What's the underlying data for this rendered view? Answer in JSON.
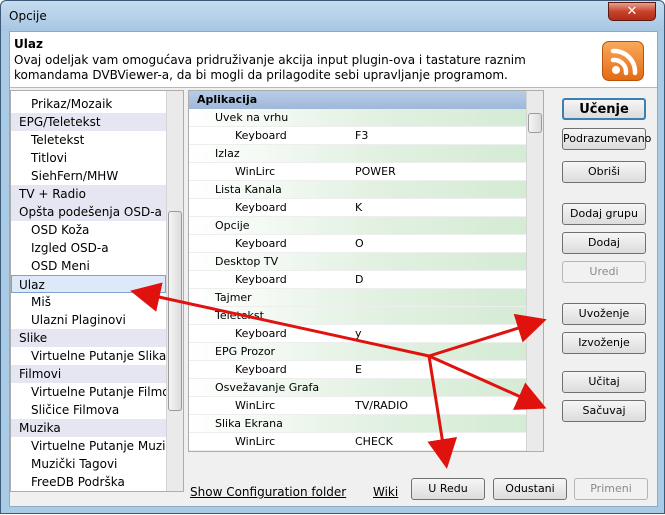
{
  "window": {
    "title": "Opcije",
    "close_label": "✕"
  },
  "header": {
    "title": "Ulaz",
    "description": "Ovaj odeljak vam omogućava pridruživanje akcija input plugin-ova i tastature raznim komandama DVBViewer-a, da bi mogli da prilagodite sebi upravljanje programom.",
    "icon": "rss-icon"
  },
  "sidebar": {
    "items": [
      {
        "label": "Prikaz/Mozaik",
        "kind": "child"
      },
      {
        "label": "EPG/Teletekst",
        "kind": "cat"
      },
      {
        "label": "Teletekst",
        "kind": "child"
      },
      {
        "label": "Titlovi",
        "kind": "child"
      },
      {
        "label": "SiehFern/MHW",
        "kind": "child"
      },
      {
        "label": "TV + Radio",
        "kind": "cat"
      },
      {
        "label": "Opšta podešenja OSD-a",
        "kind": "cat"
      },
      {
        "label": "OSD Koža",
        "kind": "child"
      },
      {
        "label": "Izgled OSD-a",
        "kind": "child"
      },
      {
        "label": "OSD Meni",
        "kind": "child"
      },
      {
        "label": "Ulaz",
        "kind": "sel"
      },
      {
        "label": "Miš",
        "kind": "child"
      },
      {
        "label": "Ulazni Plaginovi",
        "kind": "child"
      },
      {
        "label": "Slike",
        "kind": "cat"
      },
      {
        "label": "Virtuelne Putanje Slika",
        "kind": "child"
      },
      {
        "label": "Filmovi",
        "kind": "cat"
      },
      {
        "label": "Virtuelne Putanje Filmova",
        "kind": "child"
      },
      {
        "label": "Sličice Filmova",
        "kind": "child"
      },
      {
        "label": "Muzika",
        "kind": "cat"
      },
      {
        "label": "Virtuelne Putanje Muzike",
        "kind": "child"
      },
      {
        "label": "Muzički Tagovi",
        "kind": "child"
      },
      {
        "label": "FreeDB Podrška",
        "kind": "child"
      }
    ]
  },
  "grid": {
    "header": "Aplikacija",
    "rows": [
      {
        "type": "grp",
        "name": "Uvek na vrhu"
      },
      {
        "type": "itm",
        "source": "Keyboard",
        "key": "F3"
      },
      {
        "type": "grp",
        "name": "Izlaz"
      },
      {
        "type": "itm",
        "source": "WinLirc",
        "key": "POWER"
      },
      {
        "type": "grp",
        "name": "Lista Kanala"
      },
      {
        "type": "itm",
        "source": "Keyboard",
        "key": "K"
      },
      {
        "type": "grp",
        "name": "Opcije"
      },
      {
        "type": "itm",
        "source": "Keyboard",
        "key": "O"
      },
      {
        "type": "grp",
        "name": "Desktop TV"
      },
      {
        "type": "itm",
        "source": "Keyboard",
        "key": "D"
      },
      {
        "type": "grp",
        "name": "Tajmer"
      },
      {
        "type": "grp",
        "name": "Teletekst"
      },
      {
        "type": "itm",
        "source": "Keyboard",
        "key": "y"
      },
      {
        "type": "grp",
        "name": "EPG Prozor"
      },
      {
        "type": "itm",
        "source": "Keyboard",
        "key": "E"
      },
      {
        "type": "grp",
        "name": "Osvežavanje Grafa"
      },
      {
        "type": "itm",
        "source": "WinLirc",
        "key": "TV/RADIO"
      },
      {
        "type": "grp",
        "name": "Slika Ekrana"
      },
      {
        "type": "itm",
        "source": "WinLirc",
        "key": "CHECK"
      },
      {
        "type": "grp",
        "name": ""
      }
    ]
  },
  "buttons": {
    "learn": "Učenje",
    "default": "Podrazumevano",
    "delete": "Obriši",
    "add_group": "Dodaj grupu",
    "add": "Dodaj",
    "edit": "Uredi",
    "import": "Uvoženje",
    "export": "Izvoženje",
    "load": "Učitaj",
    "save": "Sačuvaj",
    "ok": "U Redu",
    "cancel": "Odustani",
    "apply": "Primeni"
  },
  "footer": {
    "config_link": "Show Configuration folder",
    "wiki_link": "Wiki"
  },
  "annotations": {
    "arrow_color": "#e0120e"
  }
}
